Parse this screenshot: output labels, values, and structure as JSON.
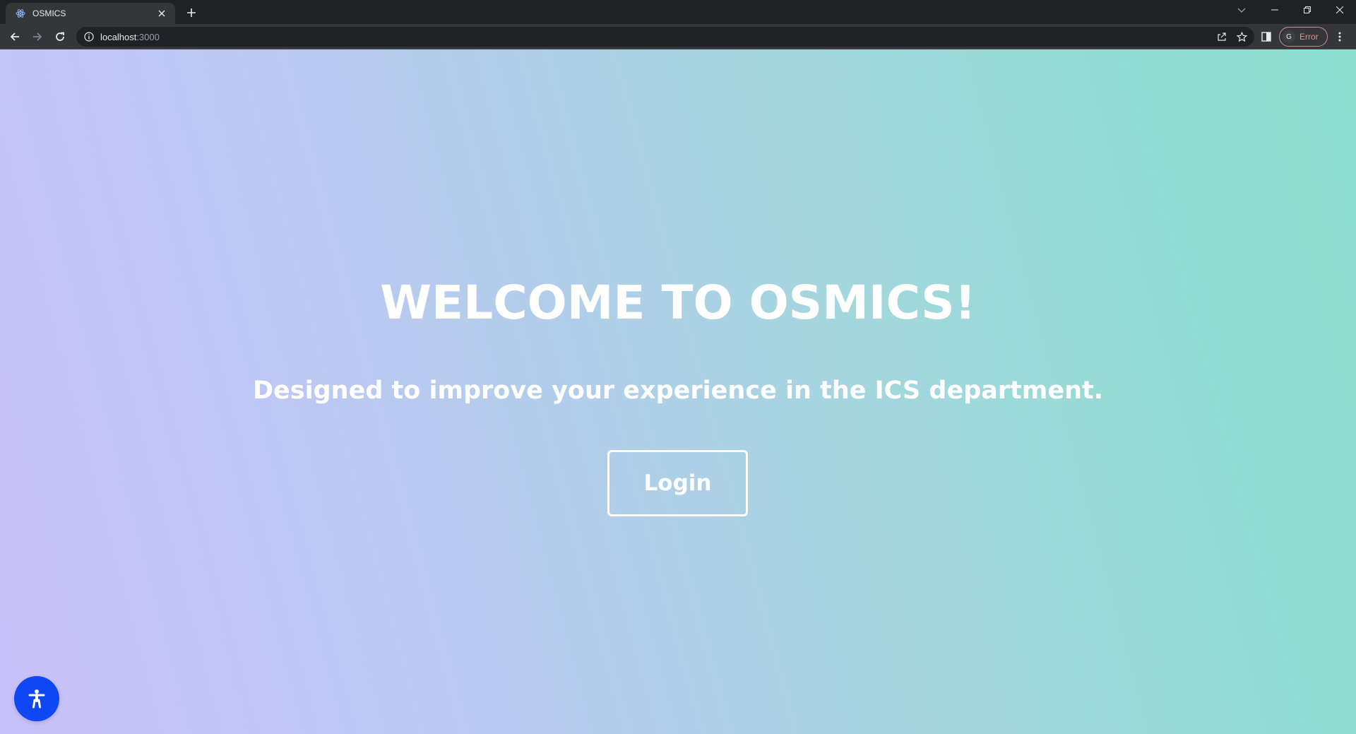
{
  "browser": {
    "tab": {
      "title": "OSMICS",
      "favicon": "react-icon"
    },
    "new_tab_icon": "+",
    "address": {
      "host": "localhost",
      "port": ":3000"
    },
    "profile": {
      "avatar_letter": "G",
      "status": "Error"
    },
    "icons": {
      "back": "arrow-left-icon",
      "forward": "arrow-right-icon",
      "reload": "reload-icon",
      "info": "info-icon",
      "share": "share-icon",
      "bookmark": "star-icon",
      "side_panel": "side-panel-icon",
      "menu": "kebab-menu-icon",
      "tab_search": "chevron-down-icon",
      "minimize": "minimize-icon",
      "restore": "restore-icon",
      "close": "close-icon"
    }
  },
  "page": {
    "title": "WELCOME TO OSMICS!",
    "subtitle": "Designed to improve your experience in the ICS department.",
    "login_label": "Login",
    "accessibility_icon": "accessibility-icon"
  },
  "colors": {
    "gradient_start": "#c8c0fa",
    "gradient_end": "#8bdfcf",
    "accessibility_button": "#0f47f5",
    "text": "#ffffff"
  }
}
